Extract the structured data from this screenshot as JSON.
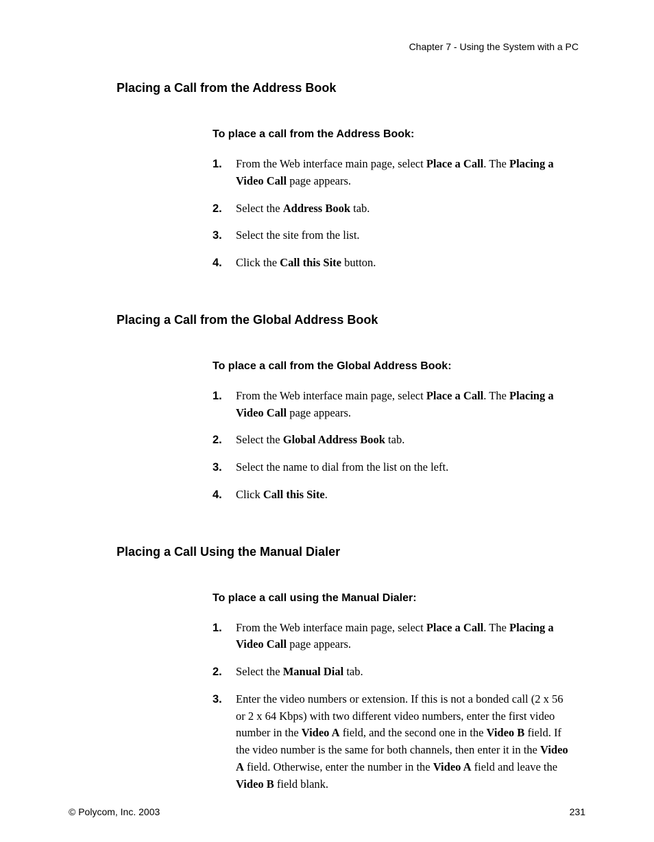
{
  "header": "Chapter 7 - Using the System with a PC",
  "sections": [
    {
      "heading": "Placing a Call from the Address Book",
      "subheading": "To place a call from the Address Book:",
      "steps": [
        {
          "num": "1.",
          "html": "From the Web interface main page, select <b>Place a Call</b>. The <b>Placing a Video Call</b> page appears."
        },
        {
          "num": "2.",
          "html": "Select the <b>Address Book</b> tab."
        },
        {
          "num": "3.",
          "html": "Select the site from the list."
        },
        {
          "num": "4.",
          "html": "Click the <b>Call this Site</b> button."
        }
      ]
    },
    {
      "heading": "Placing a Call from the Global Address Book",
      "subheading": "To place a call from the Global Address Book:",
      "steps": [
        {
          "num": "1.",
          "html": "From the Web interface main page, select <b>Place a Call</b>. The <b>Placing a Video Call</b> page appears."
        },
        {
          "num": "2.",
          "html": "Select the <b>Global Address Book</b> tab."
        },
        {
          "num": "3.",
          "html": "Select the name to dial from the list on the left."
        },
        {
          "num": "4.",
          "html": "Click <b>Call this Site</b>."
        }
      ]
    },
    {
      "heading": "Placing a Call Using the Manual Dialer",
      "subheading": "To place a call using the Manual Dialer:",
      "steps": [
        {
          "num": "1.",
          "html": "From the Web interface main page, select <b>Place a Call</b>. The <b>Placing a Video Call</b> page appears."
        },
        {
          "num": "2.",
          "html": "Select the <b>Manual Dial</b> tab."
        },
        {
          "num": "3.",
          "html": "Enter the video numbers or extension. If this is not a bonded call (2 x 56 or 2 x 64 Kbps) with two different video numbers, enter the first video number in the <b>Video A</b> field, and the second one in the <b>Video B</b> field. If the video number is the same for both channels, then enter it in the <b>Video A</b> field. Otherwise, enter the number in the <b>Video A</b> field and leave the <b>Video B</b> field blank."
        }
      ]
    }
  ],
  "footer": {
    "left": "© Polycom, Inc. 2003",
    "right": "231"
  }
}
